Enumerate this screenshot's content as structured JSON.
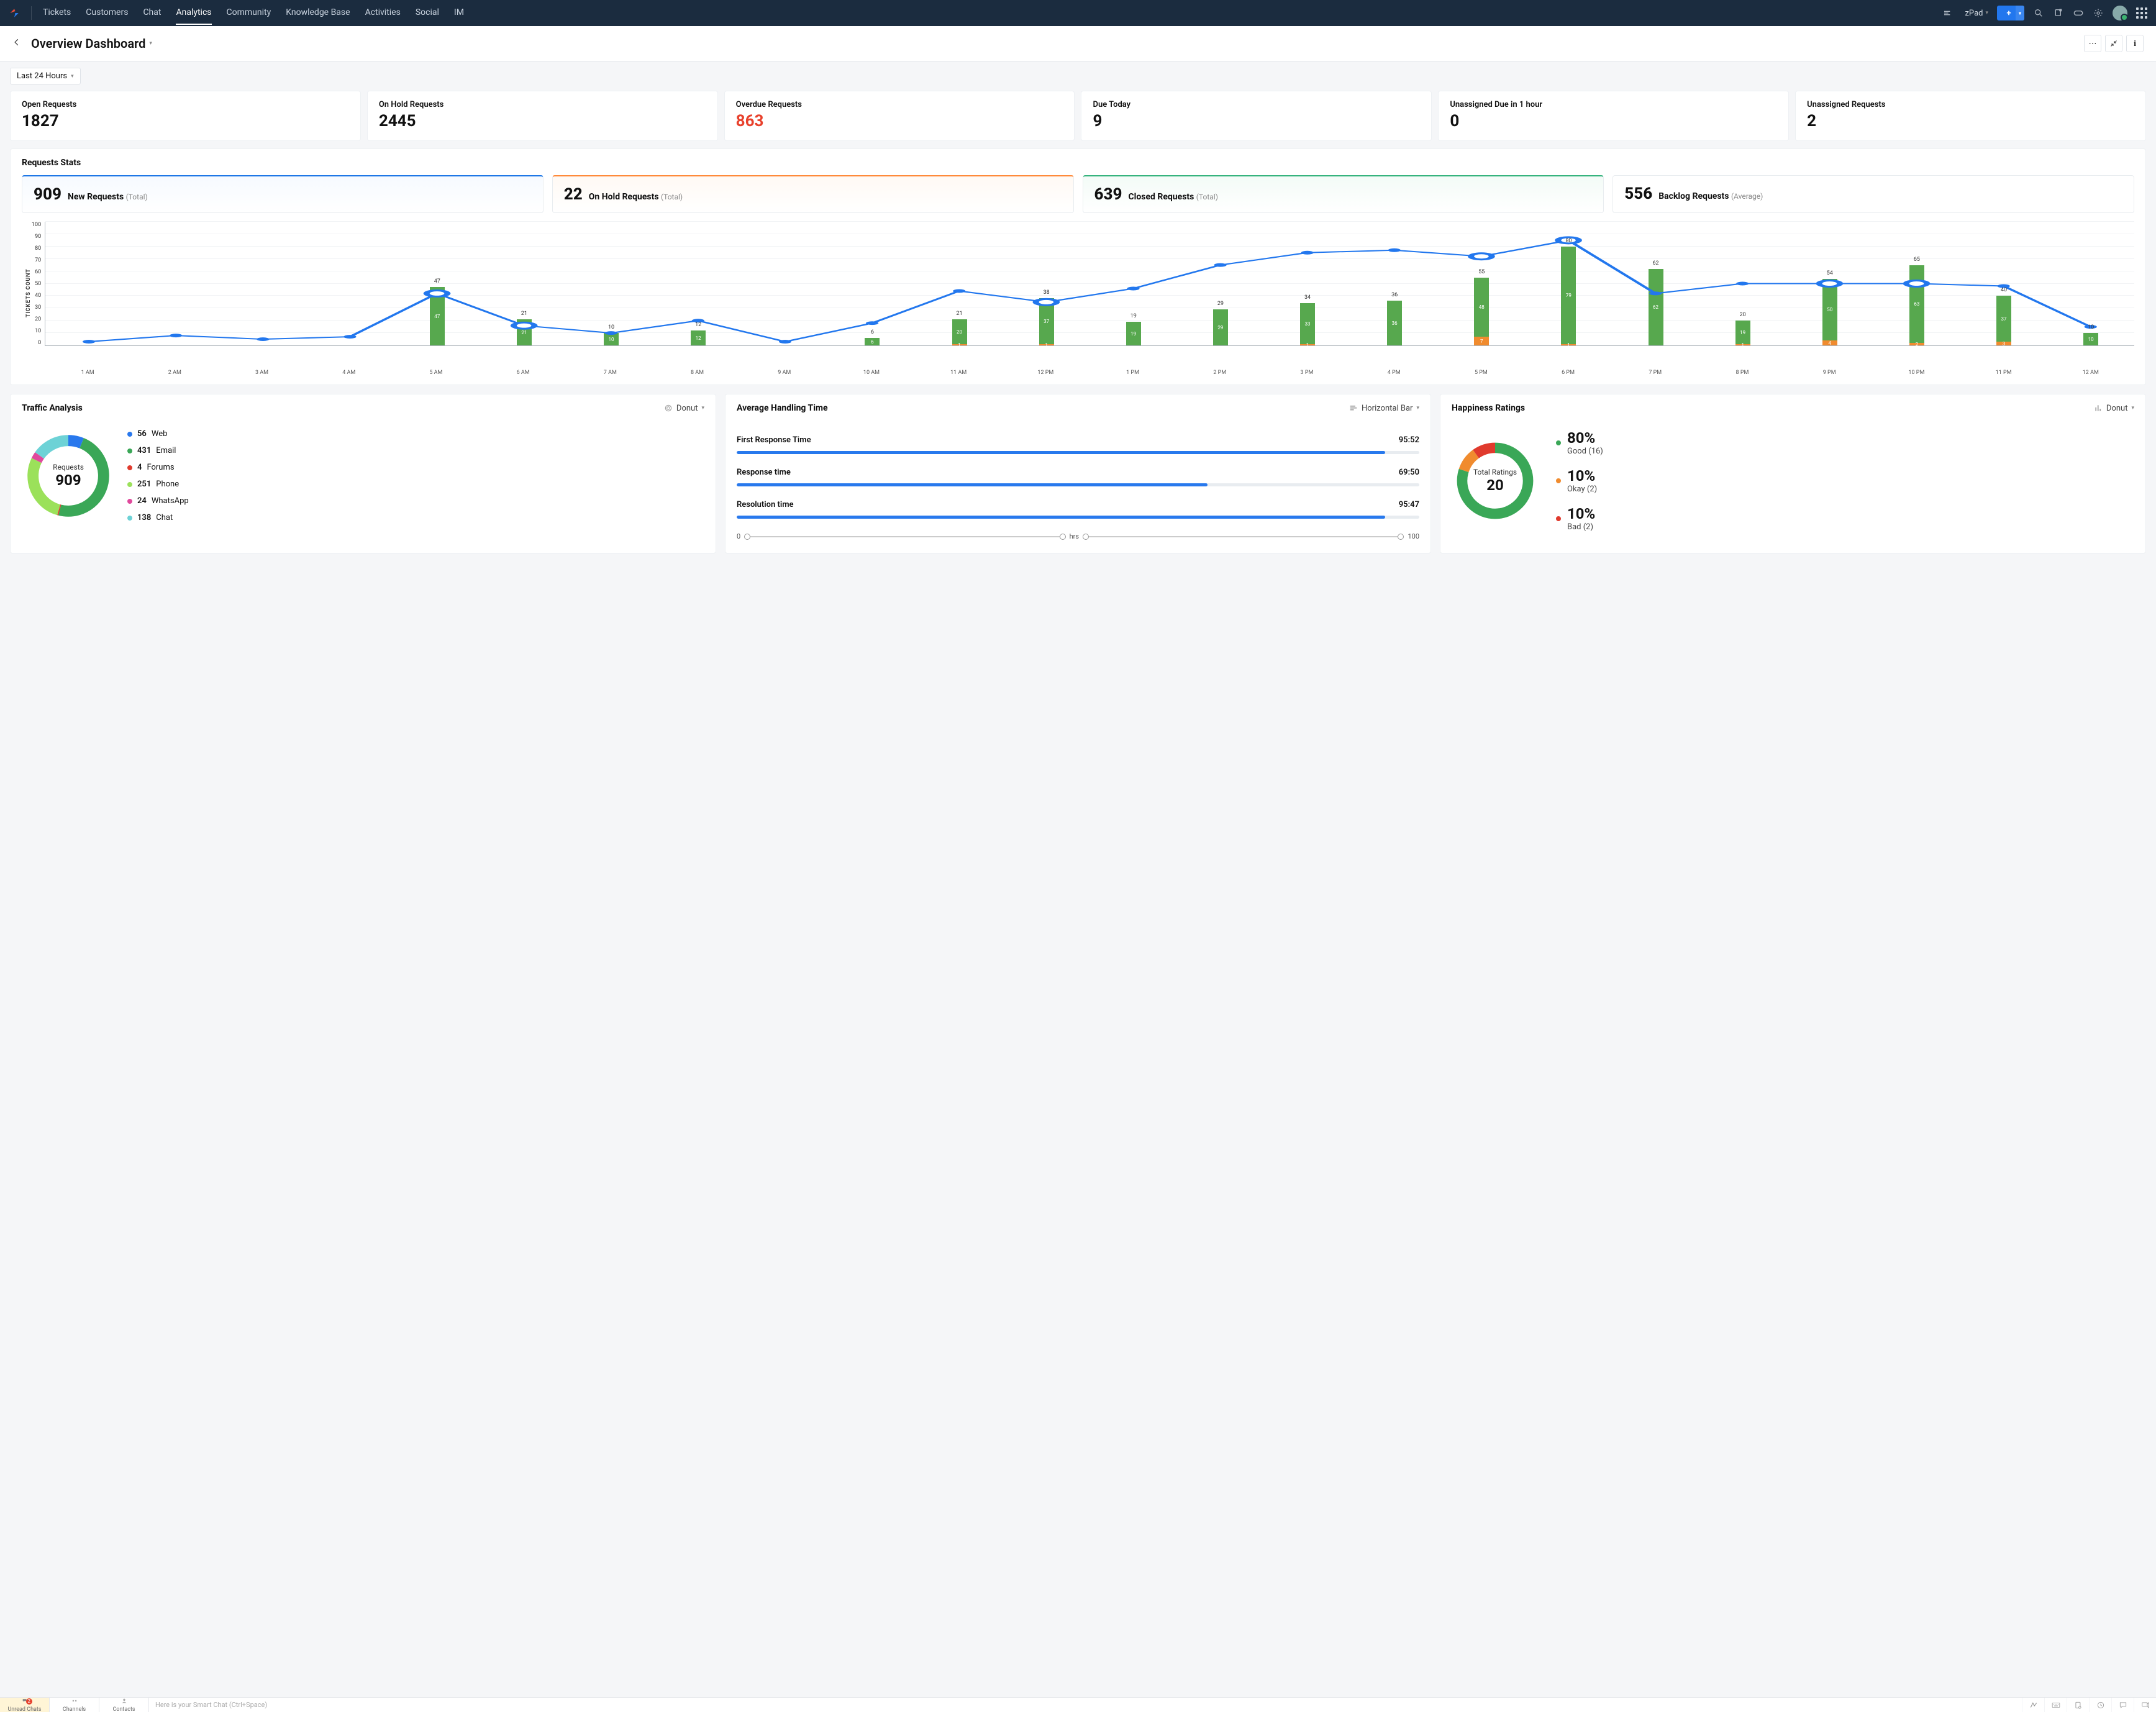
{
  "nav": {
    "tabs": [
      "Tickets",
      "Customers",
      "Chat",
      "Analytics",
      "Community",
      "Knowledge Base",
      "Activities",
      "Social",
      "IM"
    ],
    "active": "Analytics",
    "workspace": "zPad"
  },
  "page": {
    "title": "Overview Dashboard",
    "time_filter": "Last 24 Hours"
  },
  "kpis": [
    {
      "label": "Open Requests",
      "value": "1827",
      "danger": false
    },
    {
      "label": "On Hold Requests",
      "value": "2445",
      "danger": false
    },
    {
      "label": "Overdue Requests",
      "value": "863",
      "danger": true
    },
    {
      "label": "Due Today",
      "value": "9",
      "danger": false
    },
    {
      "label": "Unassigned Due in 1 hour",
      "value": "0",
      "danger": false
    },
    {
      "label": "Unassigned Requests",
      "value": "2",
      "danger": false
    }
  ],
  "requests_stats": {
    "title": "Requests Stats",
    "mini": [
      {
        "value": "909",
        "label": "New Requests",
        "sub": "(Total)",
        "variant": "blue"
      },
      {
        "value": "22",
        "label": "On Hold Requests",
        "sub": "(Total)",
        "variant": "orange"
      },
      {
        "value": "639",
        "label": "Closed Requests",
        "sub": "(Total)",
        "variant": "green"
      },
      {
        "value": "556",
        "label": "Backlog Requests",
        "sub": "(Average)",
        "variant": ""
      }
    ]
  },
  "chart_data": {
    "type": "bar",
    "ylabel": "TICKETS COUNT",
    "ylim": [
      0,
      100
    ],
    "yticks": [
      0,
      10,
      20,
      30,
      40,
      50,
      60,
      70,
      80,
      90,
      100
    ],
    "categories": [
      "1 AM",
      "2 AM",
      "3 AM",
      "4 AM",
      "5 AM",
      "6 AM",
      "7 AM",
      "8 AM",
      "9 AM",
      "10 AM",
      "11 AM",
      "12 PM",
      "1 PM",
      "2 PM",
      "3 PM",
      "4 PM",
      "5 PM",
      "6 PM",
      "7 PM",
      "8 PM",
      "9 PM",
      "10 PM",
      "11 PM",
      "12 AM"
    ],
    "bar_totals": [
      0,
      0,
      0,
      0,
      47,
      21,
      10,
      12,
      0,
      6,
      21,
      38,
      19,
      29,
      34,
      36,
      55,
      80,
      62,
      20,
      54,
      65,
      40,
      10
    ],
    "series": [
      {
        "name": "Closed",
        "color": "#57a84e",
        "values": [
          0,
          0,
          0,
          0,
          47,
          21,
          10,
          12,
          0,
          6,
          20,
          37,
          19,
          29,
          33,
          36,
          48,
          79,
          62,
          19,
          50,
          63,
          37,
          10
        ]
      },
      {
        "name": "On Hold",
        "color": "#f08b2e",
        "values": [
          0,
          0,
          0,
          0,
          0,
          0,
          0,
          0,
          0,
          0,
          1,
          1,
          0,
          0,
          1,
          0,
          7,
          1,
          0,
          1,
          4,
          2,
          3,
          0
        ]
      }
    ],
    "line_series": {
      "name": "New Requests",
      "color": "#2277ee",
      "values": [
        3,
        8,
        5,
        7,
        42,
        16,
        10,
        20,
        3,
        18,
        44,
        35,
        46,
        65,
        75,
        77,
        72,
        85,
        42,
        50,
        50,
        50,
        48,
        15
      ],
      "highlight_indices": [
        4,
        5,
        11,
        16,
        17,
        20,
        21
      ]
    }
  },
  "traffic": {
    "title": "Traffic Analysis",
    "chart_type": "Donut",
    "center_label": "Requests",
    "center_value": "909",
    "items": [
      {
        "count": "56",
        "label": "Web",
        "color": "#2878ed"
      },
      {
        "count": "431",
        "label": "Email",
        "color": "#3aa757"
      },
      {
        "count": "4",
        "label": "Forums",
        "color": "#e03a2d"
      },
      {
        "count": "251",
        "label": "Phone",
        "color": "#9be15a"
      },
      {
        "count": "24",
        "label": "WhatsApp",
        "color": "#e0499c"
      },
      {
        "count": "138",
        "label": "Chat",
        "color": "#6dd2d6"
      }
    ]
  },
  "handling": {
    "title": "Average Handling Time",
    "chart_type": "Horizontal Bar",
    "unit": "hrs",
    "axis_min": "0",
    "axis_max": "100",
    "rows": [
      {
        "label": "First Response Time",
        "value": "95:52",
        "pct": 95
      },
      {
        "label": "Response time",
        "value": "69:50",
        "pct": 69
      },
      {
        "label": "Resolution time",
        "value": "95:47",
        "pct": 95
      }
    ]
  },
  "happiness": {
    "title": "Happiness Ratings",
    "chart_type": "Donut",
    "center_label": "Total Ratings",
    "center_value": "20",
    "items": [
      {
        "pct": "80%",
        "label": "Good (16)",
        "color": "#3aa757",
        "frac": 0.8
      },
      {
        "pct": "10%",
        "label": "Okay (2)",
        "color": "#f08b2e",
        "frac": 0.1
      },
      {
        "pct": "10%",
        "label": "Bad (2)",
        "color": "#e03a2d",
        "frac": 0.1
      }
    ]
  },
  "statusbar": {
    "tabs": [
      {
        "label": "Unread Chats",
        "badge": "2",
        "active": true
      },
      {
        "label": "Channels",
        "badge": null,
        "active": false
      },
      {
        "label": "Contacts",
        "badge": null,
        "active": false
      }
    ],
    "placeholder": "Here is your Smart Chat (Ctrl+Space)"
  }
}
